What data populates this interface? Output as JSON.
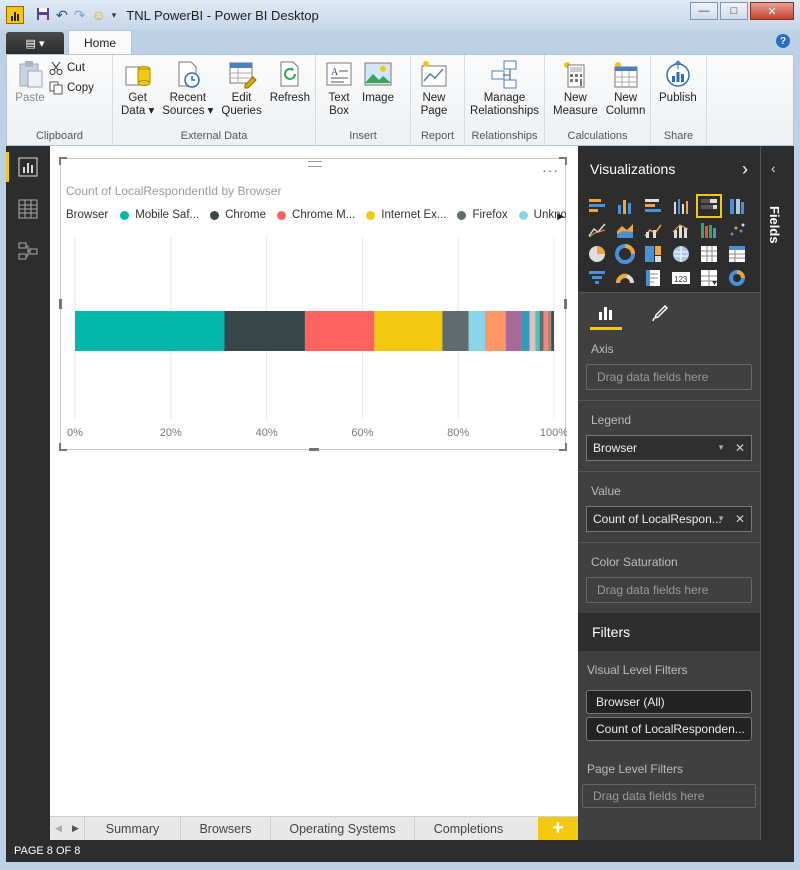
{
  "window": {
    "title": "TNL PowerBI - Power BI Desktop",
    "minimize": "—",
    "maximize": "□",
    "close": "✕"
  },
  "ribbon": {
    "file_label": "▤ ▾",
    "home_tab": "Home",
    "help": "?",
    "groups": {
      "clipboard": "Clipboard",
      "external_data": "External Data",
      "insert": "Insert",
      "report": "Report",
      "relationships": "Relationships",
      "calculations": "Calculations",
      "share": "Share"
    },
    "buttons": {
      "paste": "Paste",
      "cut": "Cut",
      "copy": "Copy",
      "get_data": "Get\nData ▾",
      "recent_sources": "Recent\nSources ▾",
      "edit_queries": "Edit\nQueries",
      "refresh": "Refresh",
      "text_box": "Text\nBox",
      "image": "Image",
      "new_page": "New\nPage",
      "manage_relationships": "Manage\nRelationships",
      "new_measure": "New\nMeasure",
      "new_column": "New\nColumn",
      "publish": "Publish"
    }
  },
  "visual": {
    "title": "Count of LocalRespondentId by Browser",
    "more": "···",
    "legend_title": "Browser",
    "legend": [
      {
        "label": "Mobile Saf...",
        "color": "#01b8aa"
      },
      {
        "label": "Chrome",
        "color": "#374649"
      },
      {
        "label": "Chrome M...",
        "color": "#fd625e"
      },
      {
        "label": "Internet Ex...",
        "color": "#f2c80f"
      },
      {
        "label": "Firefox",
        "color": "#5f6b6d"
      },
      {
        "label": "Unknown",
        "color": "#8ad4eb"
      }
    ],
    "legend_more": "▶"
  },
  "chart_data": {
    "type": "bar",
    "orientation": "horizontal-100%-stacked",
    "categories": [
      ""
    ],
    "series": [
      {
        "name": "Mobile Safari",
        "values": [
          31.2
        ],
        "color": "#01b8aa"
      },
      {
        "name": "Chrome",
        "values": [
          16.8
        ],
        "color": "#374649"
      },
      {
        "name": "Chrome Mobile",
        "values": [
          14.5
        ],
        "color": "#fd625e"
      },
      {
        "name": "Internet Explorer",
        "values": [
          14.2
        ],
        "color": "#f2c80f"
      },
      {
        "name": "Firefox",
        "values": [
          5.5
        ],
        "color": "#5f6b6d"
      },
      {
        "name": "Unknown",
        "values": [
          3.4
        ],
        "color": "#8ad4eb"
      },
      {
        "name": "",
        "values": [
          4.3
        ],
        "color": "#fe9666"
      },
      {
        "name": "",
        "values": [
          3.4
        ],
        "color": "#a66999"
      },
      {
        "name": "",
        "values": [
          1.6
        ],
        "color": "#3599b8"
      },
      {
        "name": "",
        "values": [
          1.2
        ],
        "color": "#dfbfbf"
      },
      {
        "name": "",
        "values": [
          0.9
        ],
        "color": "#4ac5bb"
      },
      {
        "name": "",
        "values": [
          0.8
        ],
        "color": "#5f6b6d"
      },
      {
        "name": "",
        "values": [
          0.9
        ],
        "color": "#fb8281"
      },
      {
        "name": "",
        "values": [
          0.7
        ],
        "color": "#a6876f"
      },
      {
        "name": "",
        "values": [
          0.6
        ],
        "color": "#3c4e5c"
      }
    ],
    "xticks": [
      "0%",
      "20%",
      "40%",
      "60%",
      "80%",
      "100%"
    ],
    "xlim": [
      0,
      100
    ],
    "grid": true
  },
  "pages": {
    "tabs": [
      "Summary",
      "Browsers",
      "Operating Systems",
      "Completions"
    ],
    "add": "+",
    "prev": "◀",
    "next": "▶"
  },
  "status": {
    "page_info": "PAGE 8 OF 8"
  },
  "viz_pane": {
    "title": "Visualizations",
    "chevron": "›",
    "axis_label": "Axis",
    "axis_drop": "Drag data fields here",
    "legend_label": "Legend",
    "legend_field": "Browser",
    "value_label": "Value",
    "value_field": "Count of LocalRespon...",
    "color_sat_label": "Color Saturation",
    "color_sat_drop": "Drag data fields here"
  },
  "filters": {
    "title": "Filters",
    "visual_level": "Visual Level Filters",
    "visual_filters": [
      "Browser (All)",
      "Count of LocalResponden..."
    ],
    "page_level": "Page Level Filters",
    "page_drop": "Drag data fields here"
  },
  "fields_pane": {
    "label": "Fields",
    "chevron": "‹"
  },
  "colors": {
    "accent": "#f2c811",
    "pane_dark": "#2d2d2d",
    "pane_mid": "#404040"
  }
}
